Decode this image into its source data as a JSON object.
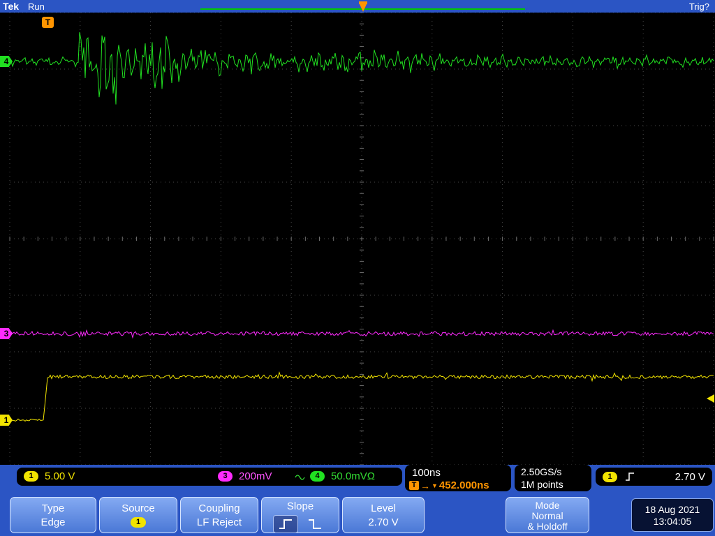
{
  "header": {
    "logo": "Tek",
    "status": "Run",
    "trig": "Trig?"
  },
  "icons": {
    "right_arrow": "→",
    "down_arrow": "▼"
  },
  "trigger_flag": "T",
  "channels": {
    "ch1": {
      "label": "1",
      "color": "#f2e400",
      "scale": "5.00 V"
    },
    "ch3": {
      "label": "3",
      "color": "#ff2bff",
      "scale": "200mV"
    },
    "ch4": {
      "label": "4",
      "color": "#21e021",
      "scale": "50.0mVΩ"
    }
  },
  "readouts": {
    "timebase": "100ns",
    "trigger_t": "T",
    "trigger_delay": "452.000ns",
    "sample_rate": "2.50GS/s",
    "record_length": "1M points",
    "trigger_source": "1",
    "trigger_level": "2.70 V"
  },
  "menu": {
    "type": {
      "title": "Type",
      "value": "Edge"
    },
    "source": {
      "title": "Source",
      "value": "1"
    },
    "coupling": {
      "title": "Coupling",
      "value": "LF Reject"
    },
    "slope": {
      "title": "Slope"
    },
    "level": {
      "title": "Level",
      "value": "2.70 V"
    },
    "mode": {
      "title": "Mode",
      "value": "Normal",
      "value2": "& Holdoff"
    },
    "datetime": {
      "date": "18 Aug 2021",
      "time": "13:04:05"
    }
  },
  "colors": {
    "panel": "#2b55c4",
    "trigger": "#ff9500",
    "graticule_bg": "#000000"
  },
  "waveforms": {
    "ch4": {
      "color": "#21e021",
      "baseline": 70,
      "idle_noise": 5,
      "burst_start": 100,
      "burst_end": 410,
      "burst_amp": 70,
      "post_noise": 11
    },
    "ch3": {
      "color": "#ff2bff",
      "baseline": 460,
      "noise": 2.8
    },
    "ch1": {
      "color": "#f2e400",
      "low": 584,
      "high": 522,
      "step_x": 48,
      "noise": 2.6
    }
  }
}
